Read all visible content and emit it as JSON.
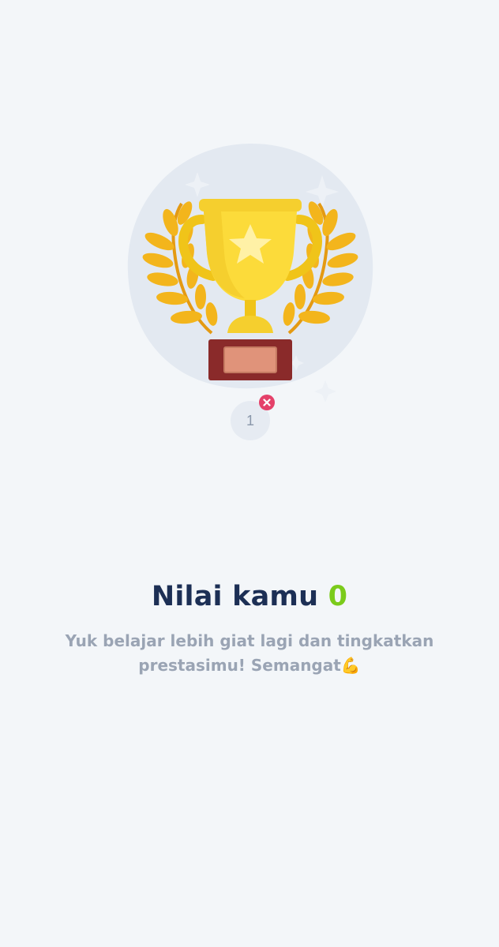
{
  "result": {
    "score_label": "Nilai kamu",
    "score_value": "0",
    "message": "Yuk belajar lebih giat lagi dan tingkatkan prestasimu! Semangat",
    "message_emoji": "💪"
  },
  "questions": [
    {
      "number": "1",
      "status": "wrong"
    }
  ],
  "colors": {
    "background": "#f3f6f9",
    "title": "#1c2f55",
    "score": "#7bcb1b",
    "message": "#9aa4b4",
    "wrong_badge": "#e4416a",
    "trophy_gold": "#fcdb3a",
    "trophy_base": "#8a2a2a"
  },
  "icons": {
    "illustration": "trophy-with-laurel",
    "wrong_badge": "close-icon"
  }
}
